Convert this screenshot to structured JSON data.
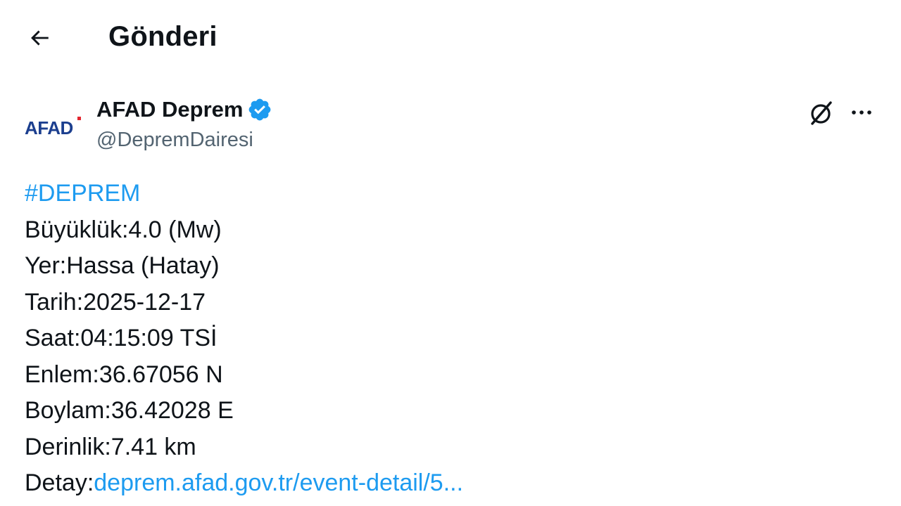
{
  "header": {
    "title": "Gönderi"
  },
  "author": {
    "logo_text": "AFAD",
    "display_name": "AFAD Deprem",
    "handle": "@DepremDairesi",
    "verified": true
  },
  "tweet": {
    "hashtag": "#DEPREM",
    "lines": [
      "Büyüklük:4.0 (Mw)",
      "Yer:Hassa (Hatay)",
      "Tarih:2025-12-17",
      "Saat:04:15:09 TSİ",
      "Enlem:36.67056 N",
      "Boylam:36.42028 E",
      "Derinlik:7.41 km"
    ],
    "detail_label": "Detay:",
    "detail_link": "deprem.afad.gov.tr/event-detail/5..."
  },
  "icons": {
    "back": "arrow-left-icon",
    "verified": "verified-badge-icon",
    "grok": "grok-icon",
    "more": "more-icon"
  },
  "colors": {
    "link": "#1d9bf0",
    "verified": "#1d9bf0",
    "logo_blue": "#1c3f8f",
    "logo_red": "#e3262f",
    "secondary_text": "#536471"
  }
}
